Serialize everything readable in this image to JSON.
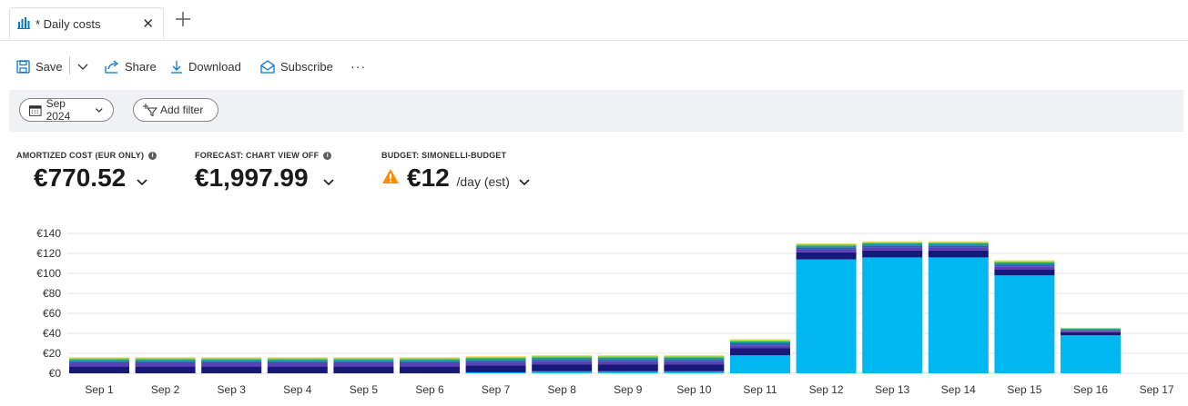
{
  "tab": {
    "title": "* Daily costs"
  },
  "toolbar": {
    "save_label": "Save",
    "share_label": "Share",
    "download_label": "Download",
    "subscribe_label": "Subscribe",
    "more_label": "···"
  },
  "filters": {
    "date_label": "Sep 2024",
    "add_filter_label": "Add filter"
  },
  "kpis": {
    "amortized": {
      "label": "AMORTIZED COST (EUR ONLY)",
      "value": "€770.52"
    },
    "forecast": {
      "label": "FORECAST: CHART VIEW OFF",
      "value": "€1,997.99"
    },
    "budget": {
      "label": "BUDGET: SIMONELLI-BUDGET",
      "value": "€12",
      "suffix": "/day (est)"
    }
  },
  "colors": {
    "cyan": "#00b7f1",
    "navy": "#17187a",
    "purple": "#5b3fb8",
    "blue": "#2f5fb3",
    "teal": "#1aa08a",
    "green": "#8fd33a",
    "yellow": "#f2d340",
    "warning": "#ff8c00"
  },
  "chart_data": {
    "type": "bar",
    "stacked": true,
    "categories": [
      "Sep 1",
      "Sep 2",
      "Sep 3",
      "Sep 4",
      "Sep 5",
      "Sep 6",
      "Sep 7",
      "Sep 8",
      "Sep 9",
      "Sep 10",
      "Sep 11",
      "Sep 12",
      "Sep 13",
      "Sep 14",
      "Sep 15",
      "Sep 16",
      "Sep 17"
    ],
    "yticks": [
      "€0",
      "€20",
      "€40",
      "€60",
      "€80",
      "€100",
      "€120",
      "€140"
    ],
    "ylim": [
      0,
      140
    ],
    "grid": true,
    "series": [
      {
        "color": "#00b7f1",
        "values": [
          0,
          0,
          0,
          0,
          0,
          0,
          1,
          2,
          2,
          2,
          18,
          114,
          116,
          116,
          98,
          38,
          0
        ]
      },
      {
        "color": "#17187a",
        "values": [
          7,
          7,
          7,
          7,
          7,
          7,
          7,
          7,
          7,
          7,
          7,
          7,
          7,
          7,
          6,
          3,
          0
        ]
      },
      {
        "color": "#5b3fb8",
        "values": [
          3,
          3,
          3,
          3,
          3,
          3,
          3,
          3,
          3,
          3,
          3,
          3,
          3,
          3,
          3,
          1.5,
          0
        ]
      },
      {
        "color": "#2f5fb3",
        "values": [
          2,
          2,
          2,
          2,
          2,
          2,
          2,
          2,
          2,
          2,
          2,
          2,
          2,
          2,
          2,
          1,
          0
        ]
      },
      {
        "color": "#1aa08a",
        "values": [
          2,
          2,
          2,
          2,
          2,
          2,
          2,
          2,
          2,
          2,
          2,
          2,
          2,
          2,
          2,
          1,
          0
        ]
      },
      {
        "color": "#8fd33a",
        "values": [
          1.2,
          1.2,
          1.2,
          1.2,
          1.2,
          1.2,
          1.2,
          1.2,
          1.2,
          1.2,
          1.2,
          1.2,
          1.2,
          1.2,
          1.2,
          0.7,
          0
        ]
      },
      {
        "color": "#f2d340",
        "values": [
          0.8,
          0.8,
          0.8,
          0.8,
          0.8,
          0.8,
          0.8,
          0.8,
          0.8,
          0.8,
          0.8,
          0.8,
          0.8,
          0.8,
          0.8,
          0.4,
          0
        ]
      }
    ]
  }
}
